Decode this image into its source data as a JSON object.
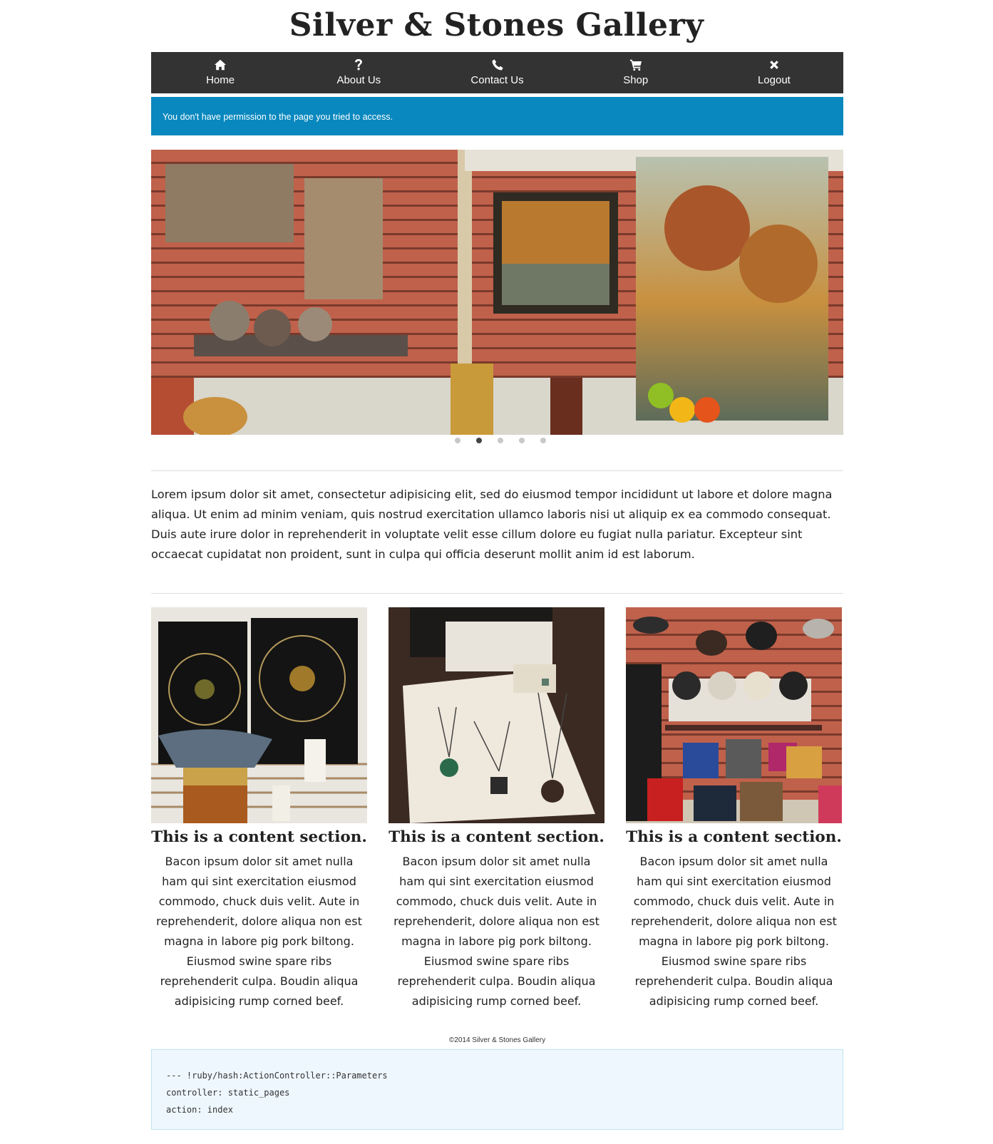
{
  "site": {
    "title": "Silver & Stones Gallery"
  },
  "nav": {
    "items": [
      {
        "label": "Home",
        "icon": "home-icon"
      },
      {
        "label": "About Us",
        "icon": "question-icon"
      },
      {
        "label": "Contact Us",
        "icon": "phone-icon"
      },
      {
        "label": "Shop",
        "icon": "cart-icon"
      },
      {
        "label": "Logout",
        "icon": "close-icon"
      }
    ]
  },
  "alert": {
    "text": "You don't have permission to the page you tried to access.",
    "color": "#0888be"
  },
  "carousel": {
    "slide_count": 5,
    "active_index": 1
  },
  "intro": {
    "text": "Lorem ipsum dolor sit amet, consectetur adipisicing elit, sed do eiusmod tempor incididunt ut labore et dolore magna aliqua. Ut enim ad minim veniam, quis nostrud exercitation ullamco laboris nisi ut aliquip ex ea commodo consequat. Duis aute irure dolor in reprehenderit in voluptate velit esse cillum dolore eu fugiat nulla pariatur. Excepteur sint occaecat cupidatat non proident, sunt in culpa qui officia deserunt mollit anim id est laborum."
  },
  "sections": [
    {
      "heading": "This is a content section.",
      "body": "Bacon ipsum dolor sit amet nulla ham qui sint exercitation eiusmod commodo, chuck duis velit. Aute in reprehenderit, dolore aliqua non est magna in labore pig pork biltong. Eiusmod swine spare ribs reprehenderit culpa. Boudin aliqua adipisicing rump corned beef."
    },
    {
      "heading": "This is a content section.",
      "body": "Bacon ipsum dolor sit amet nulla ham qui sint exercitation eiusmod commodo, chuck duis velit. Aute in reprehenderit, dolore aliqua non est magna in labore pig pork biltong. Eiusmod swine spare ribs reprehenderit culpa. Boudin aliqua adipisicing rump corned beef."
    },
    {
      "heading": "This is a content section.",
      "body": "Bacon ipsum dolor sit amet nulla ham qui sint exercitation eiusmod commodo, chuck duis velit. Aute in reprehenderit, dolore aliqua non est magna in labore pig pork biltong. Eiusmod swine spare ribs reprehenderit culpa. Boudin aliqua adipisicing rump corned beef."
    }
  ],
  "footer": {
    "text": "©2014 Silver & Stones Gallery"
  },
  "debug": {
    "lines": [
      "--- !ruby/hash:ActionController::Parameters",
      "controller: static_pages",
      "action: index"
    ]
  }
}
